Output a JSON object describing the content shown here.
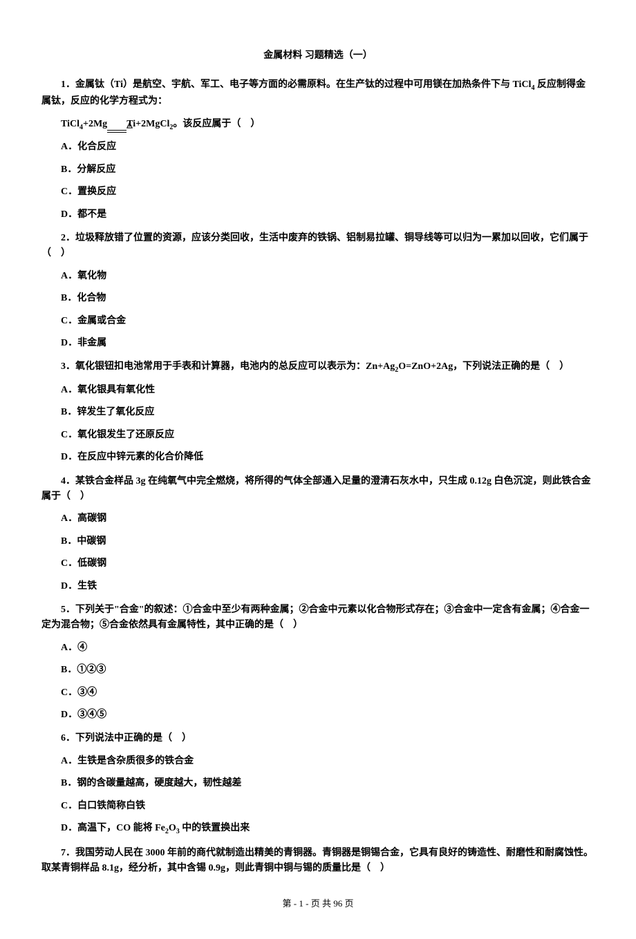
{
  "title": "金属材料 习题精选（一）",
  "q1": {
    "text_a": "1．金属钛（Ti）是航空、宇航、军工、电子等方面的必需原料。在生产钛的过程中可用镁在加热条件下与 TiCl",
    "text_b": " 反应制得金属钛，反应的化学方程式为：",
    "eq_a": "TiCl",
    "eq_b": "+2Mg",
    "eq_c": "Ti+2MgCl",
    "eq_d": "。该反应属于（　）",
    "opts": [
      "A．化合反应",
      "B．分解反应",
      "C．置换反应",
      "D．都不是"
    ]
  },
  "q2": {
    "text": "2．垃圾释放错了位置的资源，应该分类回收，生活中废弃的铁锅、铝制易拉罐、铜导线等可以归为一累加以回收，它们属于（　）",
    "opts": [
      "A．氧化物",
      "B．化合物",
      "C．金属或合金",
      "D．非金属"
    ]
  },
  "q3": {
    "text_a": "3．氧化银钮扣电池常用于手表和计算器，电池内的总反应可以表示为：Zn+Ag",
    "text_b": "O=ZnO+2Ag，下列说法正确的是（　）",
    "opts": [
      "A．氧化银具有氧化性",
      "B．锌发生了氧化反应",
      "C．氧化银发生了还原反应",
      "D．在反应中锌元素的化合价降低"
    ]
  },
  "q4": {
    "text": "4．某铁合金样品 3g 在纯氧气中完全燃烧，将所得的气体全部通入足量的澄清石灰水中，只生成 0.12g 白色沉淀，则此铁合金属于（　）",
    "opts": [
      "A．高碳钢",
      "B．中碳钢",
      "C．低碳钢",
      "D．生铁"
    ]
  },
  "q5": {
    "text": "5．下列关于\"合金\"的叙述：①合金中至少有两种金属；②合金中元素以化合物形式存在；③合金中一定含有金属；④合金一定为混合物；⑤合金依然具有金属特性，其中正确的是（　）",
    "opts": [
      "A．④",
      "B．①②③",
      "C．③④",
      "D．③④⑤"
    ]
  },
  "q6": {
    "text": "6．下列说法中正确的是（　）",
    "opts_a": "A．生铁是含杂质很多的铁合金",
    "opts_b": "B．钢的含碳量越高，硬度越大，韧性越差",
    "opts_c": "C．白口铁简称白铁",
    "opts_d_a": "D．高温下，CO 能将 Fe",
    "opts_d_b": "O",
    "opts_d_c": " 中的铁置换出来"
  },
  "q7": {
    "text": "7．我国劳动人民在 3000 年前的商代就制造出精美的青铜器。青铜器是铜锡合金，它具有良好的铸造性、耐磨性和耐腐蚀性。取某青铜样品 8.1g，经分析，其中含锡 0.9g，则此青铜中铜与锡的质量比是（　）",
    "opts": []
  },
  "footer": "第 - 1 - 页 共 96 页"
}
